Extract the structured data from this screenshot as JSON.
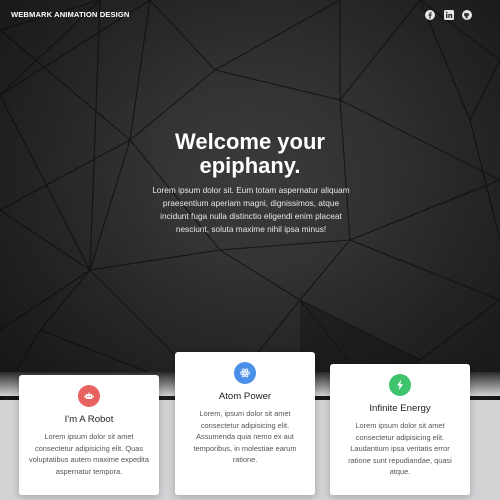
{
  "navbar": {
    "brand": "WEBMARK ANIMATION DESIGN",
    "social": [
      {
        "icon": "facebook-icon"
      },
      {
        "icon": "linkedin-icon"
      },
      {
        "icon": "github-icon"
      }
    ]
  },
  "hero": {
    "headline_line1": "Welcome your",
    "headline_line2": "epiphany.",
    "paragraph_lines": [
      "Lorem ipsum dolor sit. Eum totam aspernatur aliquam",
      "praesentium aperiam magni, dignissimos, atque",
      "incidunt fuga nulla distinctio eligendi enim placeat",
      "nesciunt, soluta maxime nihil ipsa minus!"
    ]
  },
  "features": [
    {
      "title": "I'm A Robot",
      "icon": "robot-icon",
      "color": "#e8625f",
      "lines": [
        "Lorem ipsum dolor sit amet",
        "consectetur adipisicing elit. Quas",
        "voluptatibus autem maxime expedita",
        "aspernatur tempora."
      ]
    },
    {
      "title": "Atom Power",
      "icon": "atom-icon",
      "color": "#4a8fe8",
      "lines": [
        "Lorem, ipsum dolor sit amet",
        "consectetur adipisicing elit.",
        "Assumenda quia nemo ex aut",
        "temporibus, in molestiae earum",
        "ratione."
      ]
    },
    {
      "title": "Infinite Energy",
      "icon": "lightning-icon",
      "color": "#3ec46d",
      "lines": [
        "Lorem ipsum dolor sit amet",
        "consectetur adipisicing elit.",
        "Laudantium ipsa veritatis error",
        "ratione sunt repudiandae, quasi",
        "atque."
      ]
    }
  ]
}
